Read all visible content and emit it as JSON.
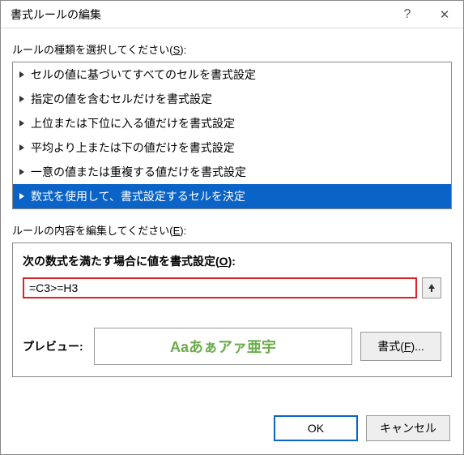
{
  "titlebar": {
    "title": "書式ルールの編集",
    "help": "?",
    "close": "✕"
  },
  "ruleType": {
    "label_pre": "ルールの種類を選択してください(",
    "accel": "S",
    "label_post": "):",
    "items": [
      {
        "label": "セルの値に基づいてすべてのセルを書式設定",
        "selected": false
      },
      {
        "label": "指定の値を含むセルだけを書式設定",
        "selected": false
      },
      {
        "label": "上位または下位に入る値だけを書式設定",
        "selected": false
      },
      {
        "label": "平均より上または下の値だけを書式設定",
        "selected": false
      },
      {
        "label": "一意の値または重複する値だけを書式設定",
        "selected": false
      },
      {
        "label": "数式を使用して、書式設定するセルを決定",
        "selected": true
      }
    ]
  },
  "ruleEdit": {
    "label_pre": "ルールの内容を編集してください(",
    "accel": "E",
    "label_post": "):"
  },
  "formula": {
    "title_pre": "次の数式を満たす場合に値を書式設定(",
    "accel": "O",
    "title_post": "):",
    "value": "=C3>=H3"
  },
  "preview": {
    "label": "プレビュー:",
    "sample": "Aaあぁアァ亜宇",
    "button_pre": "書式(",
    "accel": "F",
    "button_post": ")..."
  },
  "footer": {
    "ok": "OK",
    "cancel": "キャンセル"
  }
}
